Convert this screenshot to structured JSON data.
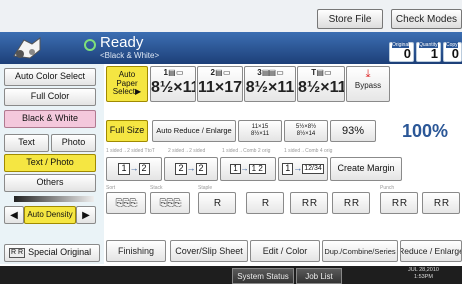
{
  "top": {
    "store_file": "Store File",
    "check_modes": "Check Modes"
  },
  "header": {
    "title": "Ready",
    "subtitle": "<Black & White>",
    "counters": [
      {
        "label": "Original",
        "value": "0"
      },
      {
        "label": "Quantity",
        "value": "1"
      },
      {
        "label": "Copy",
        "value": "0"
      }
    ]
  },
  "left": {
    "auto_color_select": "Auto Color Select",
    "full_color": "Full Color",
    "black_white": "Black & White",
    "text": "Text",
    "photo": "Photo",
    "text_photo": "Text / Photo",
    "others": "Others",
    "auto_density": "Auto Density",
    "special_original": "Special Original",
    "special_original_icon_text": "R R"
  },
  "paper": {
    "auto_paper_select": "Auto Paper Select▶",
    "trays": [
      {
        "num": "1",
        "size": "8½×11"
      },
      {
        "num": "2",
        "size": "11×17"
      },
      {
        "num": "3",
        "size": "8½×11"
      },
      {
        "num": "T",
        "size": "8½×11"
      }
    ],
    "bypass": "Bypass"
  },
  "reduce": {
    "full_size": "Full Size",
    "auto_reduce": "Auto Reduce / Enlarge",
    "r1_top": "11×15",
    "r1_bot": "8½×11",
    "r2_top": "5½×8½",
    "r2_bot": "8½×14",
    "pct": "93%",
    "current": "100%"
  },
  "duplex": {
    "label1": "1 sided→2 sided TtoT",
    "label2": "2 sided→2 sided",
    "label3": "1 sided→Comb 2 orig",
    "label4": "1 sided→Comb 4 orig",
    "btn1_a": "1",
    "btn1_b": "2",
    "btn2_a": "2",
    "btn2_b": "2",
    "btn3_a": "1",
    "btn3_b": "1 2",
    "btn4_a": "1",
    "btn4_b": "12/34",
    "create_margin": "Create Margin"
  },
  "finishing": {
    "sort_label": "Sort",
    "stack_label": "Stack",
    "staple_label": "Staple",
    "punch_label": "Punch",
    "icons": [
      "R",
      "R",
      "R R",
      "R",
      "R R",
      "R R",
      "R R",
      "R R"
    ]
  },
  "tabs": {
    "finishing": "Finishing",
    "cover_slip": "Cover/Slip Sheet",
    "edit_color": "Edit / Color",
    "dup_combine": "Dup./Combine/Series",
    "reduce_enlarge": "Reduce / Enlarge"
  },
  "status": {
    "system_status": "System Status",
    "job_list": "Job List",
    "date": "JUL  28,2010",
    "time": "1:53PM"
  },
  "colors": {
    "selected": "#f5e642",
    "header": "#2b5797",
    "pink": "#f4c8dc"
  }
}
